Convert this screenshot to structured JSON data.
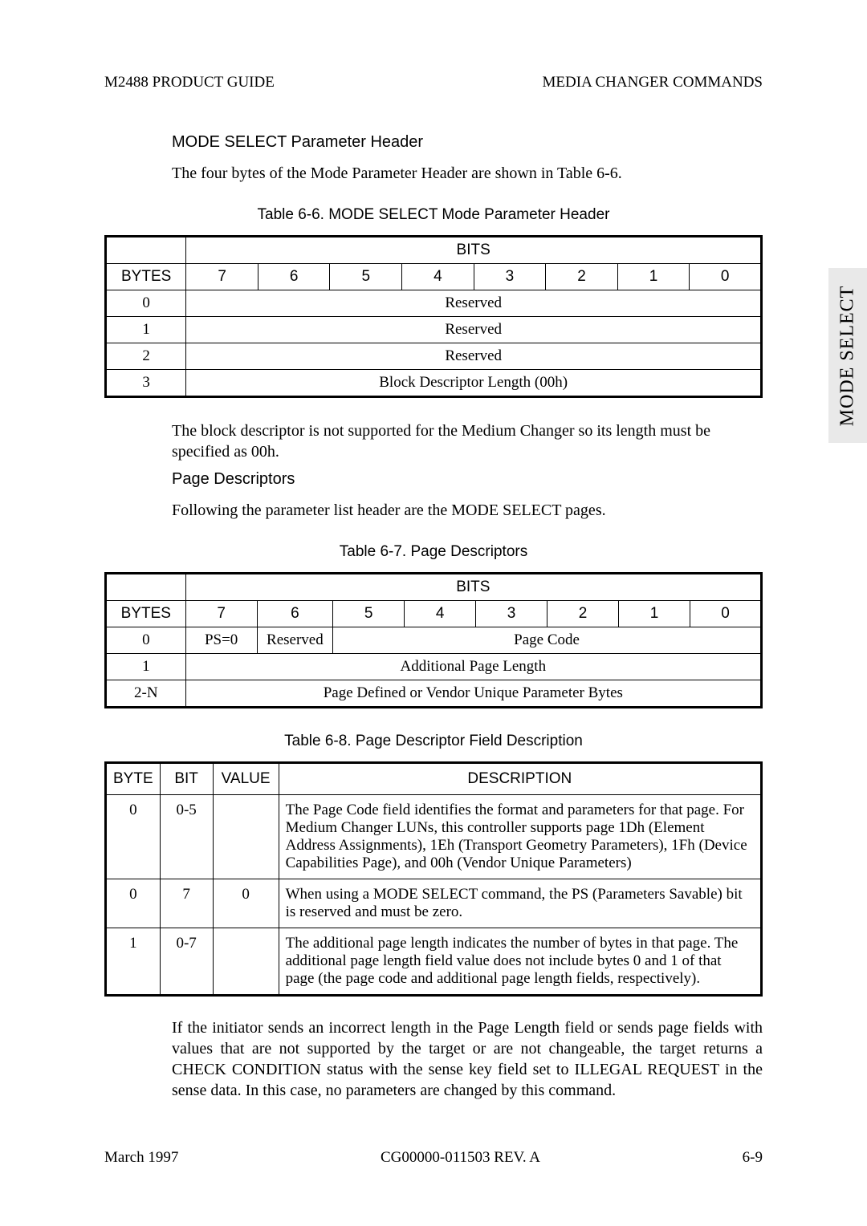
{
  "header": {
    "left": "M2488 PRODUCT GUIDE",
    "right": "MEDIA CHANGER COMMANDS"
  },
  "section1": {
    "title": "MODE SELECT Parameter Header",
    "intro": "The four bytes of the Mode Parameter Header are shown in Table 6-6.",
    "table_caption": "Table 6-6.   MODE SELECT Mode Parameter Header",
    "bits_label": "BITS",
    "bytes_label": "BYTES",
    "bit_nums": [
      "7",
      "6",
      "5",
      "4",
      "3",
      "2",
      "1",
      "0"
    ],
    "rows": [
      {
        "byte": "0",
        "text": "Reserved"
      },
      {
        "byte": "1",
        "text": "Reserved"
      },
      {
        "byte": "2",
        "text": "Reserved"
      },
      {
        "byte": "3",
        "text": "Block Descriptor Length (00h)"
      }
    ],
    "note": "The block descriptor is not supported for the Medium Changer so its length must be specified as 00h."
  },
  "section2": {
    "title": "Page Descriptors",
    "intro": "Following the parameter list header are the MODE SELECT pages.",
    "table_caption": "Table 6-7.   Page Descriptors",
    "bits_label": "BITS",
    "bytes_label": "BYTES",
    "bit_nums": [
      "7",
      "6",
      "5",
      "4",
      "3",
      "2",
      "1",
      "0"
    ],
    "row0": {
      "byte": "0",
      "ps": "PS=0",
      "reserved": "Reserved",
      "pagecode": "Page Code"
    },
    "row1": {
      "byte": "1",
      "text": "Additional Page Length"
    },
    "row2": {
      "byte": "2-N",
      "text": "Page Defined or Vendor Unique Parameter Bytes"
    }
  },
  "section3": {
    "table_caption": "Table 6-8.   Page Descriptor Field Description",
    "headers": {
      "byte": "BYTE",
      "bit": "BIT",
      "value": "VALUE",
      "desc": "DESCRIPTION"
    },
    "rows": [
      {
        "byte": "0",
        "bit": "0-5",
        "value": "",
        "desc": "The Page Code field identifies the format and parameters for that page. For Medium Changer LUNs, this controller supports page 1Dh (Element Address Assignments), 1Eh (Transport Geometry Parameters), 1Fh (Device Capabilities Page), and 00h (Vendor Unique Parameters)"
      },
      {
        "byte": "0",
        "bit": "7",
        "value": "0",
        "desc": "When using a MODE SELECT command, the PS (Parameters Savable) bit is reserved and must be zero."
      },
      {
        "byte": "1",
        "bit": "0-7",
        "value": "",
        "desc": "The additional page length indicates the number of bytes in that page. The additional page length field value does not include bytes 0 and 1 of that page (the page code and additional page length fields, respectively)."
      }
    ],
    "note": "If the initiator sends an incorrect length in the Page Length field or sends page fields with values that are not supported by the target or are not changeable, the target returns a CHECK CONDITION status with the sense key field set to ILLEGAL REQUEST in the sense data. In this case, no parameters are changed by this command."
  },
  "sidetab": "MODE SELECT",
  "footer": {
    "left": "March 1997",
    "center": "CG00000-011503 REV. A",
    "right": "6-9"
  }
}
